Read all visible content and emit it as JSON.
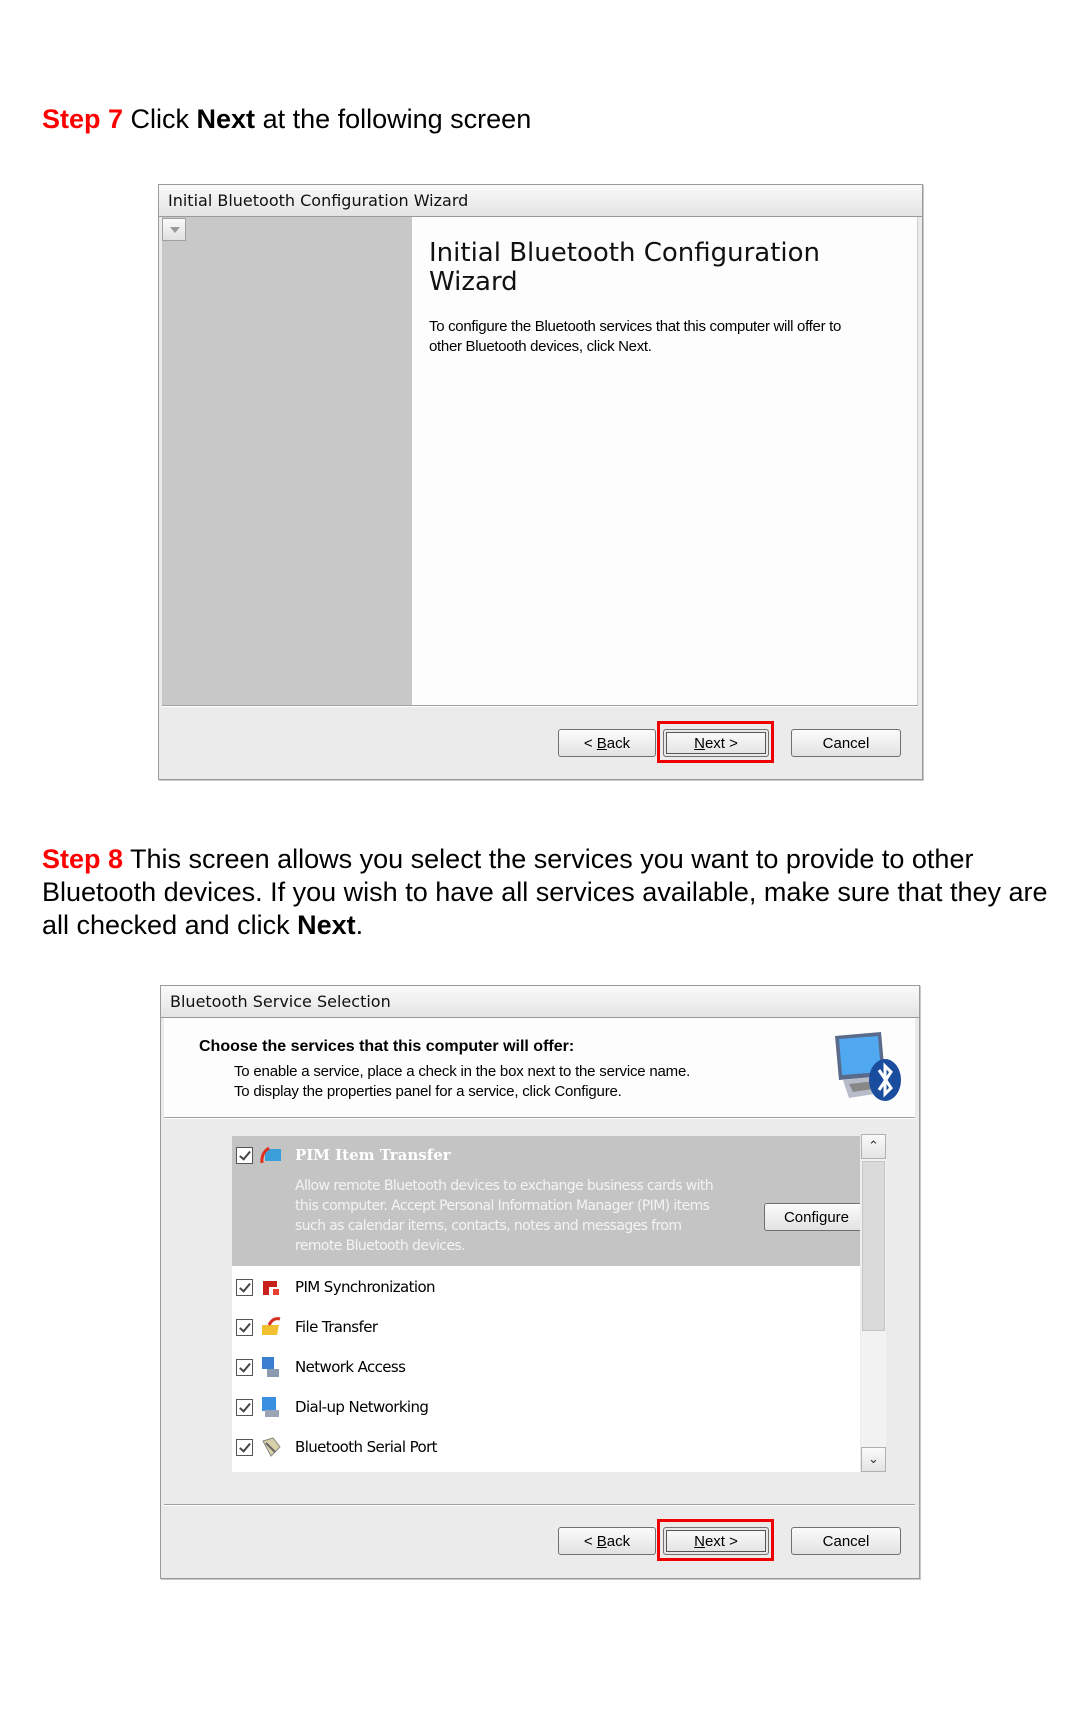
{
  "step7": {
    "label": "Step 7",
    "text_before": " Click ",
    "bold": "Next",
    "text_after": " at the following screen"
  },
  "dialog1": {
    "title": "Initial Bluetooth Configuration Wizard",
    "heading": "Initial Bluetooth Configuration Wizard",
    "description": "To configure the Bluetooth services that this computer will offer to other Bluetooth devices, click Next.",
    "buttons": {
      "back": {
        "prefix": "< ",
        "mnemonic": "B",
        "rest": "ack"
      },
      "next": {
        "mnemonic": "N",
        "rest": "ext >"
      },
      "cancel": "Cancel"
    },
    "highlight_color": "#ee0000"
  },
  "step8": {
    "label": "Step 8",
    "text": " This screen allows you select the services you want to provide to other Bluetooth devices.  If you wish to have all services available, make sure that they are all checked and click ",
    "bold": "Next",
    "text_after": "."
  },
  "dialog2": {
    "title": "Bluetooth Service Selection",
    "header_title": "Choose the services that this computer will offer:",
    "header_line1": "To enable a service, place a check in the box next to the service name.",
    "header_line2": "To display the properties panel for a service, click Configure.",
    "header_icon": "computer-bluetooth-icon",
    "services": [
      {
        "name": "PIM Item Transfer",
        "checked": true,
        "selected": true,
        "icon": "pim-transfer-icon",
        "description": "Allow remote Bluetooth devices to exchange business cards with this computer. Accept Personal Information Manager (PIM) items such as calendar items, contacts, notes and messages from remote Bluetooth devices.",
        "configure_label": "Configure"
      },
      {
        "name": "PIM Synchronization",
        "checked": true,
        "icon": "pim-sync-icon"
      },
      {
        "name": "File Transfer",
        "checked": true,
        "icon": "file-transfer-icon"
      },
      {
        "name": "Network Access",
        "checked": true,
        "icon": "network-access-icon"
      },
      {
        "name": "Dial-up Networking",
        "checked": true,
        "icon": "dialup-networking-icon"
      },
      {
        "name": "Bluetooth Serial Port",
        "checked": true,
        "icon": "serial-port-icon"
      }
    ],
    "buttons": {
      "back": {
        "prefix": "< ",
        "mnemonic": "B",
        "rest": "ack"
      },
      "next": {
        "mnemonic": "N",
        "rest": "ext >"
      },
      "cancel": "Cancel"
    },
    "highlight_color": "#ee0000"
  }
}
